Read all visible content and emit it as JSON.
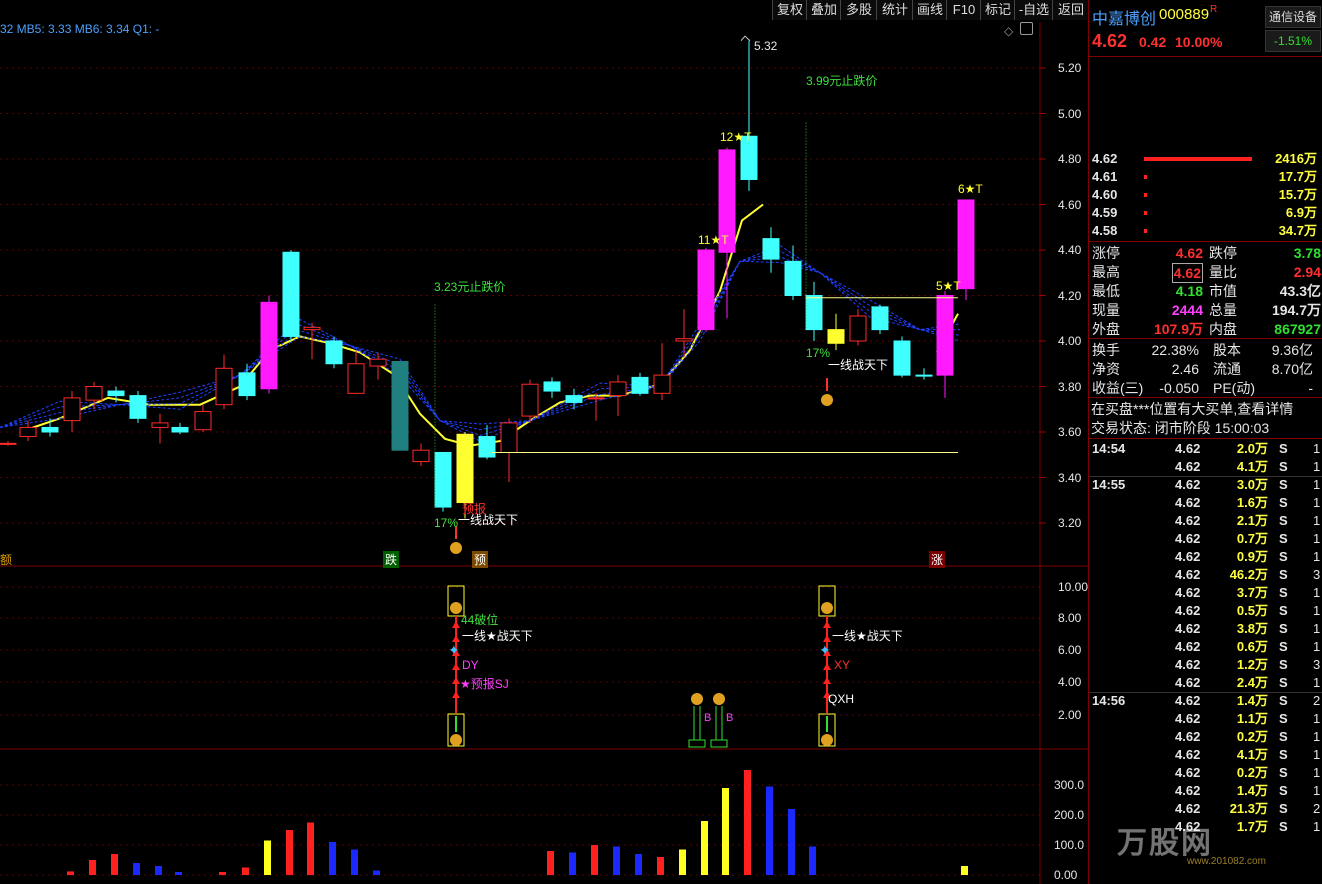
{
  "toolbar": {
    "buttons": [
      "复权",
      "叠加",
      "多股",
      "统计",
      "画线",
      "F10",
      "标记",
      "-自选",
      "返回"
    ]
  },
  "ma_header": {
    "text": "32  MB5: 3.33  MB6: 3.34  Q1: -"
  },
  "price_axis": [
    "5.20",
    "5.00",
    "4.80",
    "4.60",
    "4.40",
    "4.20",
    "4.00",
    "3.80",
    "3.60",
    "3.40",
    "3.20"
  ],
  "indicator_axis": [
    "10.00",
    "8.00",
    "6.00",
    "4.00",
    "2.00"
  ],
  "volume_axis": [
    "300.0",
    "200.0",
    "100.0",
    "0.00"
  ],
  "annotations": {
    "high_price": "5.32",
    "stop_loss_1": "3.23元止跌价",
    "stop_loss_2": "3.99元止跌价",
    "pct_1": "17%",
    "pct_2": "17%",
    "yixian_1": "一线战天下",
    "yixian_2": "一线战天下",
    "yubao": "预报",
    "star_12": "12★T",
    "star_11": "11★T",
    "star_6": "6★T",
    "star_5": "5★T",
    "bottom_tag_die": "跌",
    "bottom_tag_yu": "预",
    "bottom_tag_zhang": "涨",
    "bottom_tag_left": "额"
  },
  "indicator_labels": {
    "pojian": "44破位",
    "yixian_a": "一线★战天下",
    "dy": "DY",
    "yubao_sj": "★预报SJ",
    "yixian_b": "一线★战天下",
    "xy": "XY",
    "qxh": "QXH",
    "b1": "B",
    "b2": "B"
  },
  "stock": {
    "name": "中嘉博创",
    "code": "000889",
    "flag": "R",
    "price": "4.62",
    "change": "0.42",
    "change_pct": "10.00%",
    "tongxin_label": "通信设备",
    "tongxin_pct": "-1.51%"
  },
  "order_book": [
    {
      "price": "4.62",
      "vol": "2416万",
      "bar": 1.0
    },
    {
      "price": "4.61",
      "vol": "17.7万",
      "bar": 0.02
    },
    {
      "price": "4.60",
      "vol": "15.7万",
      "bar": 0.02
    },
    {
      "price": "4.59",
      "vol": "6.9万",
      "bar": 0.02
    },
    {
      "price": "4.58",
      "vol": "34.7万",
      "bar": 0.02
    }
  ],
  "quote": [
    {
      "l1": "涨停",
      "v1": "4.62",
      "c1": "red",
      "l2": "跌停",
      "v2": "3.78",
      "c2": "green"
    },
    {
      "l1": "最高",
      "v1": "4.62",
      "c1": "red",
      "l2": "量比",
      "v2": "2.94",
      "c2": "red"
    },
    {
      "l1": "最低",
      "v1": "4.18",
      "c1": "green",
      "l2": "市值",
      "v2": "43.3亿",
      "c2": "white"
    },
    {
      "l1": "现量",
      "v1": "2444",
      "c1": "magenta",
      "l2": "总量",
      "v2": "194.7万",
      "c2": "white"
    },
    {
      "l1": "外盘",
      "v1": "107.9万",
      "c1": "red",
      "l2": "内盘",
      "v2": "867927",
      "c2": "green"
    }
  ],
  "quote2": [
    {
      "l1": "换手",
      "v1": "22.38%",
      "l2": "股本",
      "v2": "9.36亿"
    },
    {
      "l1": "净资",
      "v1": "2.46",
      "l2": "流通",
      "v2": "8.70亿"
    },
    {
      "l1": "收益(三)",
      "v1": "-0.050",
      "l2": "PE(动)",
      "v2": "-"
    }
  ],
  "notice": "在买盘***位置有大买单,查看详情",
  "trade_status": "交易状态: 闭市阶段 15:00:03",
  "ticks": [
    {
      "time": "14:54",
      "price": "4.62",
      "vol": "2.0万",
      "side": "S",
      "n": "1"
    },
    {
      "time": "",
      "price": "4.62",
      "vol": "4.1万",
      "side": "S",
      "n": "1"
    },
    {
      "time": "14:55",
      "price": "4.62",
      "vol": "3.0万",
      "side": "S",
      "n": "1"
    },
    {
      "time": "",
      "price": "4.62",
      "vol": "1.6万",
      "side": "S",
      "n": "1"
    },
    {
      "time": "",
      "price": "4.62",
      "vol": "2.1万",
      "side": "S",
      "n": "1"
    },
    {
      "time": "",
      "price": "4.62",
      "vol": "0.7万",
      "side": "S",
      "n": "1"
    },
    {
      "time": "",
      "price": "4.62",
      "vol": "0.9万",
      "side": "S",
      "n": "1"
    },
    {
      "time": "",
      "price": "4.62",
      "vol": "46.2万",
      "side": "S",
      "n": "3"
    },
    {
      "time": "",
      "price": "4.62",
      "vol": "3.7万",
      "side": "S",
      "n": "1"
    },
    {
      "time": "",
      "price": "4.62",
      "vol": "0.5万",
      "side": "S",
      "n": "1"
    },
    {
      "time": "",
      "price": "4.62",
      "vol": "3.8万",
      "side": "S",
      "n": "1"
    },
    {
      "time": "",
      "price": "4.62",
      "vol": "0.6万",
      "side": "S",
      "n": "1"
    },
    {
      "time": "",
      "price": "4.62",
      "vol": "1.2万",
      "side": "S",
      "n": "3"
    },
    {
      "time": "",
      "price": "4.62",
      "vol": "2.4万",
      "side": "S",
      "n": "1"
    },
    {
      "time": "14:56",
      "price": "4.62",
      "vol": "1.4万",
      "side": "S",
      "n": "2"
    },
    {
      "time": "",
      "price": "4.62",
      "vol": "1.1万",
      "side": "S",
      "n": "1"
    },
    {
      "time": "",
      "price": "4.62",
      "vol": "0.2万",
      "side": "S",
      "n": "1"
    },
    {
      "time": "",
      "price": "4.62",
      "vol": "4.1万",
      "side": "S",
      "n": "1"
    },
    {
      "time": "",
      "price": "4.62",
      "vol": "0.2万",
      "side": "S",
      "n": "1"
    },
    {
      "time": "",
      "price": "4.62",
      "vol": "1.4万",
      "side": "S",
      "n": "1"
    },
    {
      "time": "",
      "price": "4.62",
      "vol": "21.3万",
      "side": "S",
      "n": "2"
    },
    {
      "time": "",
      "price": "4.62",
      "vol": "1.7万",
      "side": "S",
      "n": "1"
    }
  ],
  "watermark": "万股网",
  "watermark_url": "www.201082.com",
  "colors": {
    "up": "#ff2a2a",
    "down": "#40ffff",
    "bg": "#000000",
    "axis": "#800000",
    "accent_yellow": "#ffff30",
    "magenta": "#ff1aff"
  }
}
